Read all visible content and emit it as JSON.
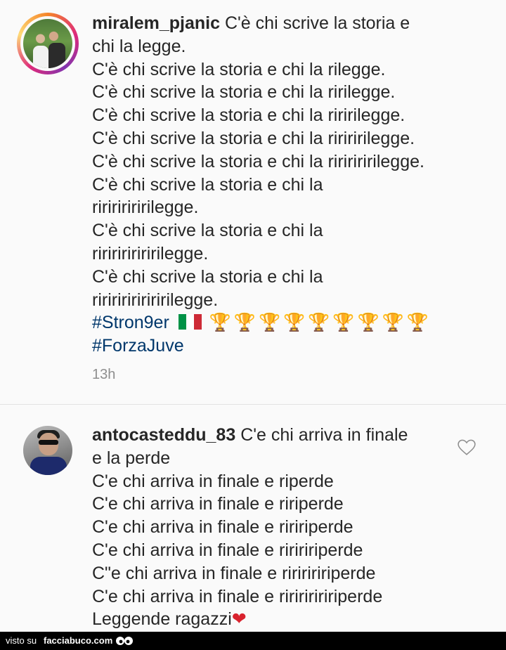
{
  "comment1": {
    "username": "miralem_pjanic",
    "lines": [
      "C'è chi scrive la storia e",
      "chi la legge.",
      "C'è chi scrive la storia e chi la rilegge.",
      "C'è chi scrive la storia e chi la ririlegge.",
      "C'è chi scrive la storia e chi la riririlegge.",
      "C'è chi scrive la storia e chi la ririririlegge.",
      "C'è chi scrive la storia e chi la riririririlegge.",
      "C'è chi scrive la storia e chi la",
      "ririririririlegge.",
      "C'è chi scrive la storia e chi la",
      "riririririririlegge.",
      "C'è chi scrive la storia e chi la",
      "ririririririririlegge."
    ],
    "hashtag1": "#Stron9er",
    "hashtag2": "#ForzaJuve",
    "trophy_count": 9,
    "time": "13h",
    "icons": [
      "italy-flag-icon",
      "trophy-icon"
    ]
  },
  "comment2": {
    "username": "antocasteddu_83",
    "lines": [
      "C'e chi arriva in finale",
      "e la perde",
      "C'e chi arriva in finale e riperde",
      "C'e chi arriva in finale e ririperde",
      "C'e chi arriva in finale e riririperde",
      "C'e chi arriva in finale e ririririperde",
      "C\"e chi arriva in finale e riririririperde",
      "C'e chi arriva in finale e ririririririperde",
      "Leggende ragazzi"
    ],
    "icons": [
      "heart-icon",
      "red-heart-emoji"
    ]
  },
  "footer": {
    "visto": "visto su",
    "site": "facciabuco.com"
  },
  "colors": {
    "background": "#fafafa",
    "text": "#262626",
    "hashtag": "#00376b",
    "muted": "#8e8e8e",
    "trophy": "#d4a017",
    "heart": "#d9232e"
  }
}
